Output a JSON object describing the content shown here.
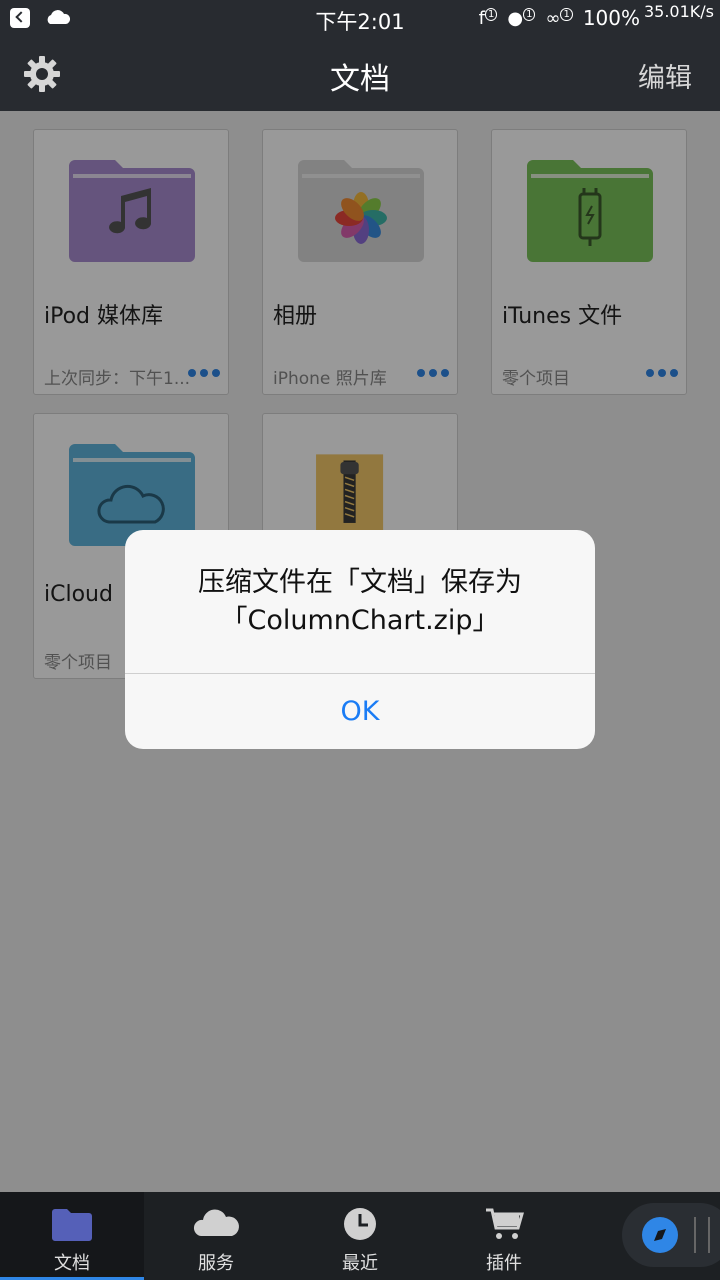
{
  "status_bar": {
    "time": "下午2:01",
    "battery": "100%",
    "network_speed": "35.01K/s",
    "notification_badge": "1"
  },
  "nav": {
    "title": "文档",
    "edit_label": "编辑"
  },
  "cards": [
    {
      "name": "iPod 媒体库",
      "subtitle": "上次同步：下午1...",
      "folder_color": "#a98cd0",
      "icon": "music-note-icon"
    },
    {
      "name": "相册",
      "subtitle": "iPhone 照片库",
      "folder_color": "#d9d9d9",
      "icon": "photos-flower-icon"
    },
    {
      "name": "iTunes 文件",
      "subtitle": "零个项目",
      "folder_color": "#7bc45a",
      "icon": "usb-cable-icon"
    },
    {
      "name": "iCloud",
      "subtitle": "零个项目",
      "folder_color": "#5fb5dc",
      "icon": "cloud-icon"
    },
    {
      "name": "",
      "subtitle": "",
      "folder_color": "#f3c969",
      "icon": "zip-archive-icon"
    }
  ],
  "alert": {
    "message_line1": "压缩文件在「文档」保存为",
    "message_line2": "「ColumnChart.zip」",
    "ok_label": "OK"
  },
  "tabs": [
    {
      "label": "文档",
      "icon": "folder-icon",
      "active": true
    },
    {
      "label": "服务",
      "icon": "cloud-icon"
    },
    {
      "label": "最近",
      "icon": "clock-icon"
    },
    {
      "label": "插件",
      "icon": "cart-icon"
    }
  ],
  "colors": {
    "accent": "#2f86e6",
    "bar_bg": "#282b30",
    "alert_button": "#1a7cf5"
  }
}
